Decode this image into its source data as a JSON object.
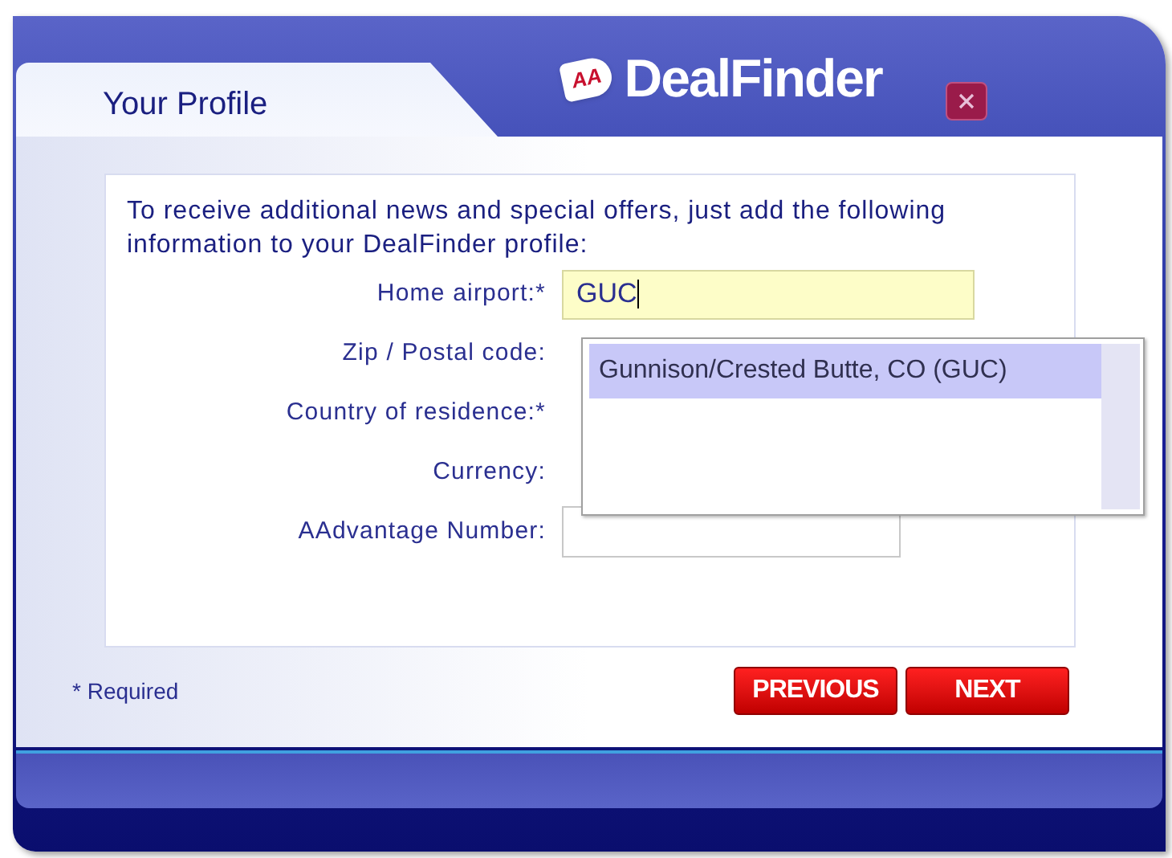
{
  "header": {
    "tab_title": "Your Profile",
    "logo_mark": "AA",
    "brand": "DealFinder"
  },
  "intro": "To receive additional news and special offers, just add the following information to your DealFinder profile:",
  "fields": [
    {
      "label": "Home airport:*",
      "kind": "input",
      "value": "GUC",
      "focused": true
    },
    {
      "label": "Zip / Postal code:",
      "kind": "covered"
    },
    {
      "label": "Country of residence:*",
      "kind": "covered"
    },
    {
      "label": "Currency:",
      "kind": "covered"
    },
    {
      "label": "AAdvantage Number:",
      "kind": "input",
      "focused": false
    }
  ],
  "suggestions": [
    {
      "text": "Gunnison/Crested Butte, CO (GUC)",
      "selected": true
    }
  ],
  "footnote": "* Required",
  "buttons": [
    "PREVIOUS",
    "NEXT"
  ]
}
